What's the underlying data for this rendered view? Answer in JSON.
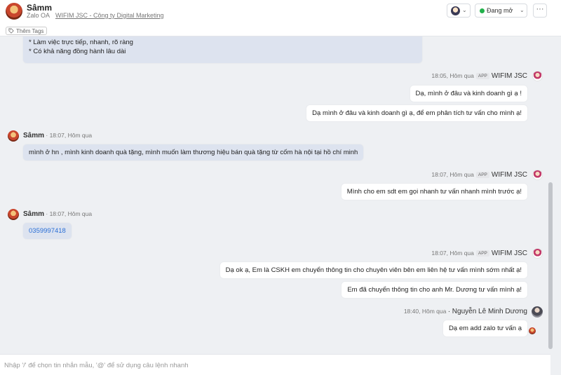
{
  "header": {
    "contact_name": "Sâmm",
    "channel": "Zalo OA",
    "company": "WIFIM JSC - Công ty Digital Marketing",
    "add_tags": "Thêm Tags",
    "status": "Đang mở",
    "more": "···",
    "chevron": "⌄"
  },
  "messages": [
    {
      "text1": "* Làm việc trực tiếp, nhanh, rõ ràng",
      "text2": "* Có khả năng đồng hành lâu dài"
    },
    {
      "time": "18:05, Hôm qua",
      "badge": "APP",
      "sender": "WIFIM JSC",
      "bubbles": [
        "Dạ, mình ở đâu và kinh doanh gì ạ !",
        "Dạ mình ở đâu và kinh doanh gì ạ, để em phân tích tư vấn cho mình ạ!"
      ]
    },
    {
      "sender": "Sâmm",
      "time": "· 18:07, Hôm qua",
      "text": "mình ở hn , mình kinh doanh quà tặng, mình muốn làm thương hiệu bán quà tặng từ cốm hà nội tại hồ chí minh"
    },
    {
      "time": "18:07, Hôm qua",
      "badge": "APP",
      "sender": "WIFIM JSC",
      "text": "Mình cho em sdt em gọi nhanh tư vấn nhanh mình trước ạ!"
    },
    {
      "sender": "Sâmm",
      "time": "· 18:07, Hôm qua",
      "text": "0359997418"
    },
    {
      "time": "18:07, Hôm qua",
      "badge": "APP",
      "sender": "WIFIM JSC",
      "bubbles": [
        "Dạ ok ạ, Em là CSKH em chuyển thông tin cho chuyên viên bên em liên hệ tư vấn mình sớm nhất ạ!",
        "Em đã chuyển thông tin cho anh Mr. Dương tư vấn mình ạ!"
      ]
    },
    {
      "time": "18:40, Hôm qua",
      "sender": "· Nguyễn Lê Minh Dương",
      "text": "Dạ em add zalo tư vấn ạ"
    }
  ],
  "composer": {
    "placeholder": "Nhập '/' để chọn tin nhắn mẫu, '@' để sử dụng câu lệnh nhanh"
  },
  "colors": {
    "status_green": "#22b14c",
    "incoming_bubble": "#dde3ef",
    "phone_link": "#2a6fd6"
  }
}
